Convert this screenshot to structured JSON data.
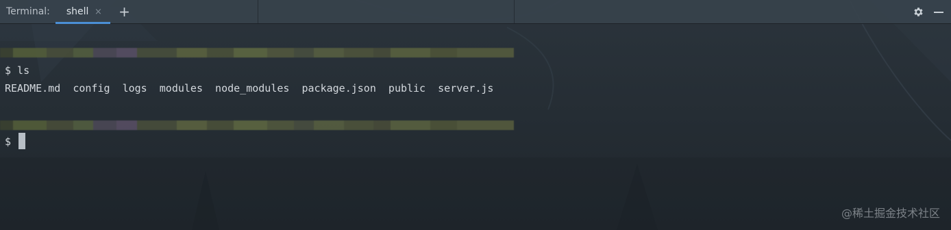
{
  "tabbar": {
    "title": "Terminal:",
    "tabs": [
      {
        "label": "shell",
        "active": true,
        "close_glyph": "×"
      }
    ],
    "add_tab_glyph": "+",
    "actions": [
      {
        "name": "settings",
        "icon": "gear-icon"
      },
      {
        "name": "hide",
        "icon": "minimize-icon"
      }
    ]
  },
  "terminal": {
    "lines": [
      {
        "text": "$ ls"
      },
      {
        "text": "README.md  config  logs  modules  node_modules  package.json  public  server.js"
      },
      {
        "text": "$ "
      }
    ],
    "redacted_rows": 2
  },
  "watermark": "@稀土掘金技术社区",
  "colors": {
    "background": "#232a31",
    "tabbar": "#37424c",
    "tab_underline": "#4b8fd6",
    "text": "#d4d9de",
    "cursor": "#b8bfc6"
  }
}
